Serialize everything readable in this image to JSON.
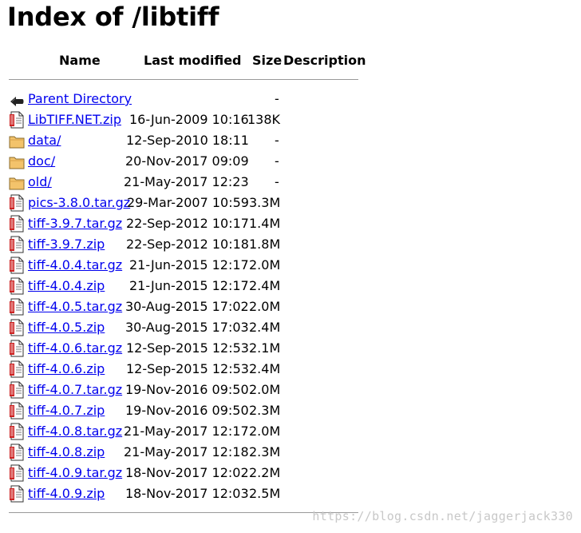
{
  "page": {
    "title": "Index of /libtiff"
  },
  "columns": {
    "name": "Name",
    "last_modified": "Last modified",
    "size": "Size",
    "description": "Description"
  },
  "rows": [
    {
      "name": "Parent Directory",
      "date": "",
      "size": "-",
      "icon": "back-icon"
    },
    {
      "name": "LibTIFF.NET.zip",
      "date": "16-Jun-2009 10:16",
      "size": "138K",
      "icon": "archive-file-icon"
    },
    {
      "name": "data/",
      "date": "12-Sep-2010 18:11",
      "size": "-",
      "icon": "folder-icon"
    },
    {
      "name": "doc/",
      "date": "20-Nov-2017 09:09",
      "size": "-",
      "icon": "folder-icon"
    },
    {
      "name": "old/",
      "date": "21-May-2017 12:23",
      "size": "-",
      "icon": "folder-icon"
    },
    {
      "name": "pics-3.8.0.tar.gz",
      "date": "29-Mar-2007 10:59",
      "size": "3.3M",
      "icon": "archive-file-icon"
    },
    {
      "name": "tiff-3.9.7.tar.gz",
      "date": "22-Sep-2012 10:17",
      "size": "1.4M",
      "icon": "archive-file-icon"
    },
    {
      "name": "tiff-3.9.7.zip",
      "date": "22-Sep-2012 10:18",
      "size": "1.8M",
      "icon": "archive-file-icon"
    },
    {
      "name": "tiff-4.0.4.tar.gz",
      "date": "21-Jun-2015 12:17",
      "size": "2.0M",
      "icon": "archive-file-icon"
    },
    {
      "name": "tiff-4.0.4.zip",
      "date": "21-Jun-2015 12:17",
      "size": "2.4M",
      "icon": "archive-file-icon"
    },
    {
      "name": "tiff-4.0.5.tar.gz",
      "date": "30-Aug-2015 17:02",
      "size": "2.0M",
      "icon": "archive-file-icon"
    },
    {
      "name": "tiff-4.0.5.zip",
      "date": "30-Aug-2015 17:03",
      "size": "2.4M",
      "icon": "archive-file-icon"
    },
    {
      "name": "tiff-4.0.6.tar.gz",
      "date": "12-Sep-2015 12:53",
      "size": "2.1M",
      "icon": "archive-file-icon"
    },
    {
      "name": "tiff-4.0.6.zip",
      "date": "12-Sep-2015 12:53",
      "size": "2.4M",
      "icon": "archive-file-icon"
    },
    {
      "name": "tiff-4.0.7.tar.gz",
      "date": "19-Nov-2016 09:50",
      "size": "2.0M",
      "icon": "archive-file-icon"
    },
    {
      "name": "tiff-4.0.7.zip",
      "date": "19-Nov-2016 09:50",
      "size": "2.3M",
      "icon": "archive-file-icon"
    },
    {
      "name": "tiff-4.0.8.tar.gz",
      "date": "21-May-2017 12:17",
      "size": "2.0M",
      "icon": "archive-file-icon"
    },
    {
      "name": "tiff-4.0.8.zip",
      "date": "21-May-2017 12:18",
      "size": "2.3M",
      "icon": "archive-file-icon"
    },
    {
      "name": "tiff-4.0.9.tar.gz",
      "date": "18-Nov-2017 12:02",
      "size": "2.2M",
      "icon": "archive-file-icon"
    },
    {
      "name": "tiff-4.0.9.zip",
      "date": "18-Nov-2017 12:03",
      "size": "2.5M",
      "icon": "archive-file-icon"
    }
  ],
  "watermark": "https://blog.csdn.net/jaggerjack330",
  "colors": {
    "link": "#0000ee",
    "rule": "#999999",
    "folder": "#f3c36b",
    "archive_red": "#cc2222"
  }
}
